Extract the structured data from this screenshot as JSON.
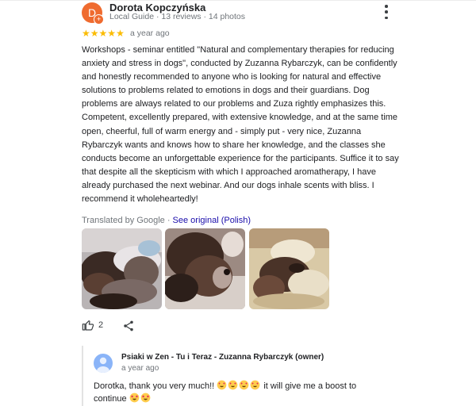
{
  "review": {
    "author_initial": "D",
    "author_name": "Dorota Kopczyńska",
    "author_meta": "Local Guide · 13 reviews · 14 photos",
    "rating": 5,
    "time": "a year ago",
    "text": "Workshops - seminar entitled \"Natural and complementary therapies for reducing anxiety and stress in dogs\", conducted by Zuzanna Rybarczyk, can be confidently and honestly recommended to anyone who is looking for natural and effective solutions to problems related to emotions in dogs and their guardians. Dog problems are always related to our problems and Zuza rightly emphasizes this. Competent, excellently prepared, with extensive knowledge, and at the same time open, cheerful, full of warm energy and - simply put - very nice, Zuzanna Rybarczyk wants and knows how to share her knowledge, and the classes she conducts become an unforgettable experience for the participants. Suffice it to say that despite all the skepticism with which I approached aromatherapy, I have already purchased the next webinar. And our dogs inhale scents with bliss. I recommend it wholeheartedly!",
    "translated_label": "Translated by Google · ",
    "see_original_label": "See original (Polish)",
    "like_count": "2",
    "avatar_color": "#ef6b2f",
    "star_color": "#fbbc04"
  },
  "icons": {
    "more": "more-vert-icon",
    "like": "thumb-up-icon",
    "share": "share-icon"
  },
  "reply": {
    "owner_name": "Psiaki w Zen - Tu i Teraz - Zuzanna Rybarczyk (owner)",
    "time": "a year ago",
    "text_part1": "Dorotka, thank you very much!! ",
    "text_part2": " it will give me a boost to continue "
  }
}
